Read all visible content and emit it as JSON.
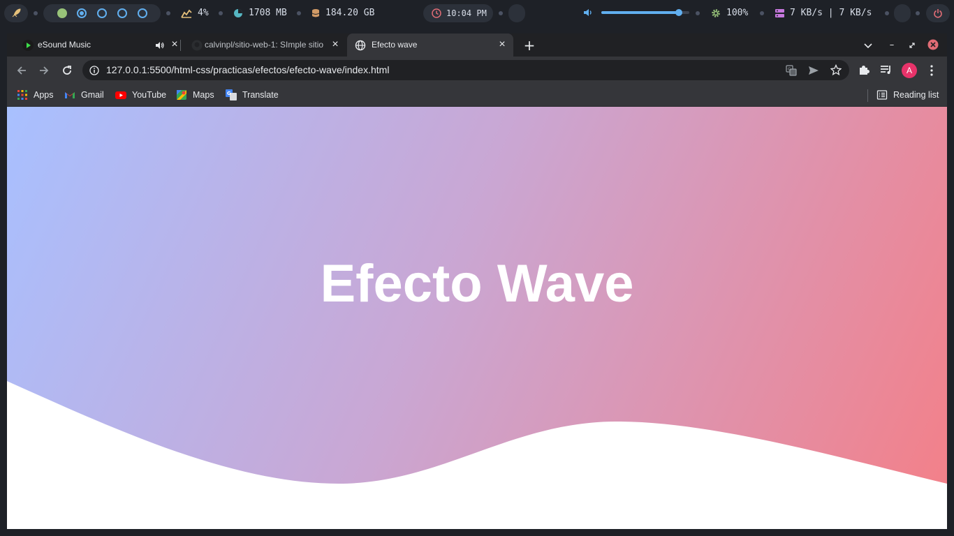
{
  "system_bar": {
    "cpu": "4%",
    "memory": "1708 MB",
    "disk": "184.20 GB",
    "clock": "10:04 PM",
    "volume": 0.88,
    "brightness": "100%",
    "network": "7 KB/s | 7 KB/s",
    "workspaces": 5,
    "accent": "#61afef"
  },
  "browser": {
    "tabs": [
      {
        "title": "eSound Music",
        "active": false
      },
      {
        "title": "calvinpl/sitio-web-1: SImple sitio",
        "active": false
      },
      {
        "title": "Efecto wave",
        "active": true
      }
    ],
    "url": "127.0.0.1:5500/html-css/practicas/efectos/efecto-wave/index.html",
    "profile_initial": "A",
    "bookmarks": [
      {
        "label": "Apps",
        "icon": "apps-grid-icon"
      },
      {
        "label": "Gmail",
        "icon": "gmail-icon"
      },
      {
        "label": "YouTube",
        "icon": "youtube-icon"
      },
      {
        "label": "Maps",
        "icon": "maps-icon"
      },
      {
        "label": "Translate",
        "icon": "translate-icon"
      }
    ],
    "reading_list": "Reading list"
  },
  "page": {
    "title": "Efecto Wave",
    "gradient_start": "#a8c0ff",
    "gradient_mid": "#c9a7d4",
    "gradient_end": "#f47f87"
  }
}
